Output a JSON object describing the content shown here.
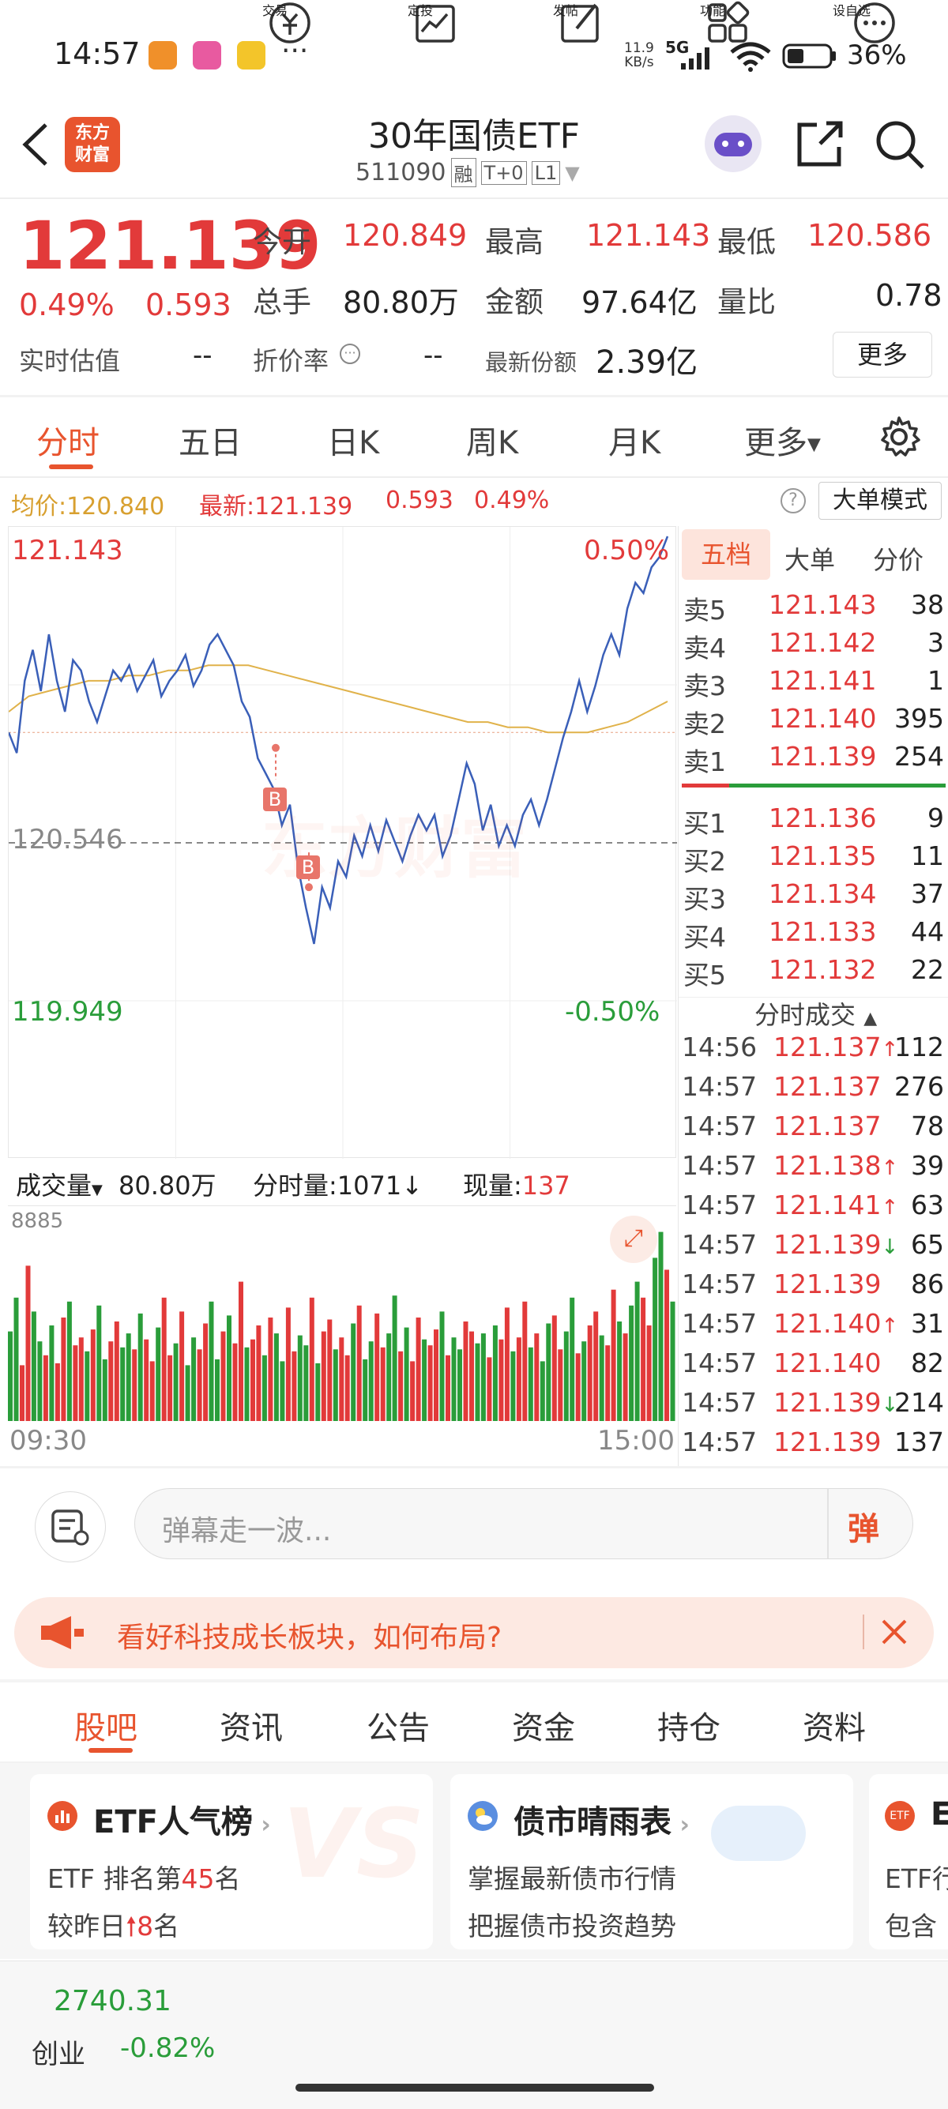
{
  "status": {
    "time": "14:57",
    "dots": "···",
    "net_speed_top": "11.9",
    "net_speed_bottom": "KB/s",
    "net": "5G",
    "battery": "36%"
  },
  "header": {
    "title": "30年国债ETF",
    "code": "511090",
    "badges": [
      "融",
      "T+0",
      "L1"
    ],
    "logo_line1": "东方",
    "logo_line2": "财富"
  },
  "quote": {
    "price": "121.139",
    "pct": "0.49%",
    "chg": "0.593",
    "open_label": "今开",
    "open": "120.849",
    "high_label": "最高",
    "high": "121.143",
    "low_label": "最低",
    "low": "120.586",
    "vol_label": "总手",
    "vol": "80.80万",
    "amt_label": "金额",
    "amt": "97.64亿",
    "ratio_label": "量比",
    "ratio": "0.78",
    "est_label": "实时估值",
    "est": "--",
    "disc_label": "折价率",
    "disc": "--",
    "share_label": "最新份额",
    "share": "2.39亿",
    "more": "更多"
  },
  "tabs": [
    "分时",
    "五日",
    "日K",
    "周K",
    "月K",
    "更多"
  ],
  "chart_head": {
    "avg_label": "均价:",
    "avg": "120.840",
    "last_label": "最新:",
    "last": "121.139",
    "chg": "0.593",
    "pct": "0.49%",
    "mode": "大单模式"
  },
  "chart_data": {
    "type": "line",
    "y_top": "121.143",
    "y_mid": "120.546",
    "y_bottom": "119.949",
    "pct_top": "0.50%",
    "pct_bottom": "-0.50%",
    "ylim": [
      119.949,
      121.143
    ],
    "series": [
      {
        "values": [
          120.76,
          120.72,
          120.86,
          120.92,
          120.84,
          120.95,
          120.86,
          120.8,
          120.9,
          120.88,
          120.82,
          120.78,
          120.83,
          120.88,
          120.86,
          120.89,
          120.84,
          120.87,
          120.9,
          120.83,
          120.86,
          120.88,
          120.91,
          120.85,
          120.88,
          120.93,
          120.95,
          120.92,
          120.89,
          120.82,
          120.79,
          120.71,
          120.68,
          120.65,
          120.58,
          120.62,
          120.5,
          120.42,
          120.35,
          120.46,
          120.42,
          120.51,
          120.48,
          120.56,
          120.52,
          120.58,
          120.53,
          120.59,
          120.55,
          120.51,
          120.56,
          120.6,
          120.57,
          120.6,
          120.52,
          120.56,
          120.63,
          120.7,
          120.66,
          120.57,
          120.62,
          120.54,
          120.58,
          120.54,
          120.6,
          120.63,
          120.58,
          120.63,
          120.69,
          120.75,
          120.8,
          120.86,
          120.8,
          120.85,
          120.91,
          120.95,
          120.91,
          121.0,
          121.05,
          121.03,
          121.08,
          121.1,
          121.14
        ]
      },
      {
        "values": [
          120.8,
          120.83,
          120.84,
          120.85,
          120.86,
          120.86,
          120.87,
          120.87,
          120.88,
          120.88,
          120.89,
          120.89,
          120.89,
          120.88,
          120.87,
          120.86,
          120.85,
          120.84,
          120.83,
          120.82,
          120.81,
          120.8,
          120.79,
          120.78,
          120.78,
          120.77,
          120.77,
          120.76,
          120.76,
          120.76,
          120.77,
          120.78,
          120.8,
          120.82
        ]
      }
    ],
    "marks": [
      "B",
      "B"
    ],
    "vol_label": "成交量",
    "vol_total": "80.80万",
    "fsl_label": "分时量:",
    "fsl": "1071",
    "now_label": "现量:",
    "now": "137",
    "vol_max": "8885",
    "time_start": "09:30",
    "time_end": "15:00",
    "volumes": [
      45,
      62,
      28,
      78,
      55,
      40,
      33,
      48,
      29,
      52,
      60,
      38,
      42,
      35,
      46,
      58,
      31,
      40,
      50,
      37,
      44,
      36,
      54,
      41,
      30,
      47,
      62,
      33,
      39,
      55,
      28,
      42,
      36,
      49,
      60,
      31,
      45,
      53,
      39,
      70,
      37,
      41,
      48,
      33,
      52,
      44,
      30,
      57,
      35,
      43,
      38,
      62,
      29,
      45,
      51,
      36,
      42,
      33,
      49,
      58,
      31,
      40,
      54,
      37,
      44,
      63,
      35,
      47,
      30,
      52,
      41,
      38,
      46,
      55,
      33,
      42,
      36,
      50,
      45,
      39,
      44,
      32,
      48,
      41,
      57,
      35,
      42,
      60,
      37,
      44,
      30,
      49,
      53,
      36,
      45,
      62,
      34,
      40,
      48,
      55,
      43,
      38,
      66,
      50,
      44,
      58,
      70,
      62,
      48,
      82,
      95,
      76,
      60
    ]
  },
  "orderbook": {
    "tabs": [
      "五档",
      "大单",
      "分价"
    ],
    "asks": [
      {
        "l": "卖5",
        "p": "121.143",
        "v": "38"
      },
      {
        "l": "卖4",
        "p": "121.142",
        "v": "3"
      },
      {
        "l": "卖3",
        "p": "121.141",
        "v": "1"
      },
      {
        "l": "卖2",
        "p": "121.140",
        "v": "395"
      },
      {
        "l": "卖1",
        "p": "121.139",
        "v": "254"
      }
    ],
    "bids": [
      {
        "l": "买1",
        "p": "121.136",
        "v": "9"
      },
      {
        "l": "买2",
        "p": "121.135",
        "v": "11"
      },
      {
        "l": "买3",
        "p": "121.134",
        "v": "37"
      },
      {
        "l": "买4",
        "p": "121.133",
        "v": "44"
      },
      {
        "l": "买5",
        "p": "121.132",
        "v": "22"
      }
    ],
    "ticks_title": "分时成交",
    "ticks": [
      {
        "t": "14:56",
        "p": "121.137",
        "a": "↑",
        "v": "112",
        "c": "red"
      },
      {
        "t": "14:57",
        "p": "121.137",
        "a": "",
        "v": "276",
        "c": "red"
      },
      {
        "t": "14:57",
        "p": "121.137",
        "a": "",
        "v": "78",
        "c": "green"
      },
      {
        "t": "14:57",
        "p": "121.138",
        "a": "↑",
        "v": "39",
        "c": "red"
      },
      {
        "t": "14:57",
        "p": "121.141",
        "a": "↑",
        "v": "63",
        "c": "red"
      },
      {
        "t": "14:57",
        "p": "121.139",
        "a": "↓",
        "v": "65",
        "c": "green"
      },
      {
        "t": "14:57",
        "p": "121.139",
        "a": "",
        "v": "86",
        "c": "green"
      },
      {
        "t": "14:57",
        "p": "121.140",
        "a": "↑",
        "v": "31",
        "c": "red"
      },
      {
        "t": "14:57",
        "p": "121.140",
        "a": "",
        "v": "82",
        "c": "red"
      },
      {
        "t": "14:57",
        "p": "121.139",
        "a": "↓",
        "v": "214",
        "c": "green"
      },
      {
        "t": "14:57",
        "p": "121.139",
        "a": "",
        "v": "137",
        "c": "red"
      }
    ]
  },
  "comment": {
    "placeholder": "弹幕走一波...",
    "danmu": "弹"
  },
  "promo": {
    "text": "看好科技成长板块，如何布局?"
  },
  "lower_tabs": [
    "股吧",
    "资讯",
    "公告",
    "资金",
    "持仓",
    "资料"
  ],
  "cards": [
    {
      "title": "ETF人气榜",
      "line1_pre": "ETF 排名第",
      "line1_num": "45",
      "line1_post": "名",
      "line2_pre": "较昨日",
      "line2_num": "8",
      "line2_post": "名"
    },
    {
      "title": "债市晴雨表",
      "line1": "掌握最新债市行情",
      "line2": "把握债市投资趋势"
    },
    {
      "title": "E",
      "line1": "ETF行",
      "line2": "包含"
    }
  ],
  "bottom": {
    "index_val": "2740.31",
    "index_name": "创业",
    "index_pct": "-0.82%",
    "items": [
      "交易",
      "定投",
      "发帖",
      "功能",
      "设自选"
    ]
  },
  "colors": {
    "red": "#e23a3a",
    "green": "#2a9d3a",
    "brand": "#e8542e",
    "avg_line": "#e0b24a",
    "price_line": "#3a5fb8"
  }
}
